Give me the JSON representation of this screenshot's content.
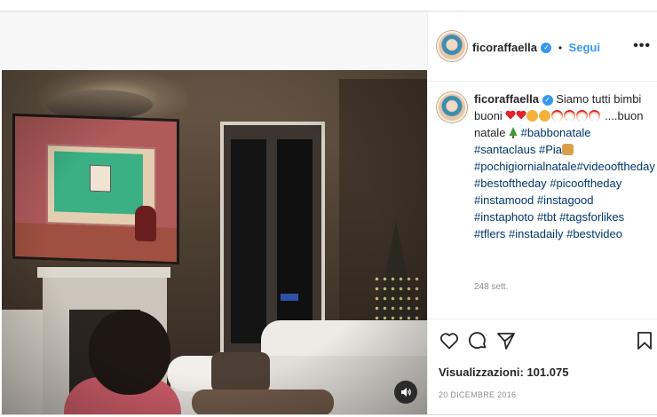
{
  "post": {
    "username": "ficoraffaella",
    "follow_label": "Segui",
    "separator": "•",
    "more_label": "•••",
    "caption": {
      "lead": "Siamo tutti bimbi buoni",
      "after_emojis": "....buon natale",
      "hashtags": [
        "#babbonatale",
        "#santaclaus",
        "#Pia",
        "#pochigiornialnatale",
        "#videooftheday",
        "#bestoftheday",
        "#picooftheday",
        "#instamood",
        "#instagood",
        "#instaphoto",
        "#tbt",
        "#tagsforlikes",
        "#tflers",
        "#instadaily",
        "#bestvideo"
      ]
    },
    "time_ago": "248 sett.",
    "views_label": "Visualizzazioni: 101.075",
    "date": "20 DICEMBRE 2016"
  },
  "icons": {
    "verified": "verified-badge-icon",
    "like": "heart-icon",
    "comment": "comment-icon",
    "share": "send-icon",
    "save": "bookmark-icon",
    "audio": "speaker-icon",
    "caption_emojis": [
      "red-heart",
      "red-heart",
      "smiling-face-with-heart-eyes",
      "smiling-face-with-heart-eyes",
      "santa-face",
      "santa-face",
      "santa-face",
      "santa-face",
      "christmas-tree"
    ]
  },
  "colors": {
    "link": "#00376b",
    "follow": "#3897f0",
    "muted": "#8e8e8e",
    "text": "#262626"
  }
}
